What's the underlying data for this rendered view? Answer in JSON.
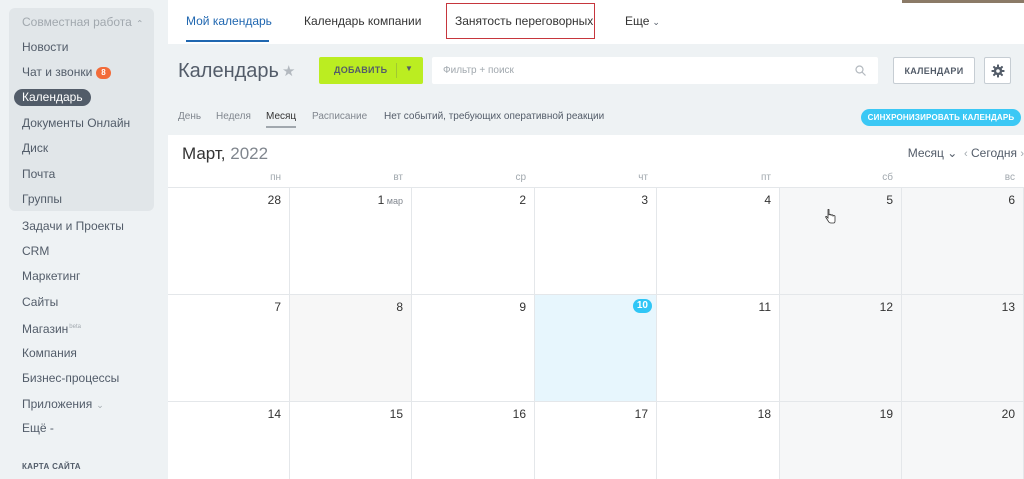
{
  "sidebar": {
    "group_header": "Совместная работа",
    "items": [
      {
        "label": "Новости"
      },
      {
        "label": "Чат и звонки",
        "badge": "8"
      },
      {
        "label": "Календарь",
        "active": true
      },
      {
        "label": "Документы Онлайн"
      },
      {
        "label": "Диск"
      },
      {
        "label": "Почта"
      },
      {
        "label": "Группы"
      },
      {
        "label": "Задачи и Проекты"
      },
      {
        "label": "CRM"
      },
      {
        "label": "Маркетинг"
      },
      {
        "label": "Сайты"
      },
      {
        "label": "Магазин",
        "sup": "beta"
      },
      {
        "label": "Компания"
      },
      {
        "label": "Бизнес-процессы"
      },
      {
        "label": "Приложения"
      },
      {
        "label": "Ещё -"
      }
    ],
    "sitemap": "КАРТА САЙТА"
  },
  "topnav": {
    "tabs": [
      {
        "label": "Мой календарь",
        "active": true
      },
      {
        "label": "Календарь компании"
      },
      {
        "label": "Занятость переговорных",
        "highlighted": true
      },
      {
        "label": "Еще"
      }
    ]
  },
  "header": {
    "title": "Календарь",
    "add_label": "ДОБАВИТЬ",
    "filter_placeholder": "Фильтр + поиск",
    "calendars_label": "КАЛЕНДАРИ"
  },
  "views": {
    "items": [
      "День",
      "Неделя",
      "Месяц",
      "Расписание"
    ],
    "active": "Месяц",
    "note": "Нет событий, требующих оперативной реакции",
    "sync_label": "СИНХРОНИЗИРОВАТЬ КАЛЕНДАРЬ"
  },
  "calendar": {
    "month": "Март,",
    "year": "2022",
    "view_select": "Месяц",
    "today_label": "Сегодня",
    "weekdays": [
      "пн",
      "вт",
      "ср",
      "чт",
      "пт",
      "сб",
      "вс"
    ],
    "weeks": [
      [
        {
          "d": "28"
        },
        {
          "d": "1",
          "suffix": "мар"
        },
        {
          "d": "2"
        },
        {
          "d": "3"
        },
        {
          "d": "4"
        },
        {
          "d": "5"
        },
        {
          "d": "6"
        }
      ],
      [
        {
          "d": "7"
        },
        {
          "d": "8"
        },
        {
          "d": "9"
        },
        {
          "d": "10",
          "today": true
        },
        {
          "d": "11"
        },
        {
          "d": "12"
        },
        {
          "d": "13"
        }
      ],
      [
        {
          "d": "14"
        },
        {
          "d": "15"
        },
        {
          "d": "16"
        },
        {
          "d": "17"
        },
        {
          "d": "18"
        },
        {
          "d": "19"
        },
        {
          "d": "20"
        }
      ]
    ]
  },
  "colors": {
    "accent": "#2067b0",
    "add_button": "#bbed21",
    "sync_button": "#3bc8f5",
    "badge": "#f26b39",
    "highlight_box": "#c6363d"
  }
}
